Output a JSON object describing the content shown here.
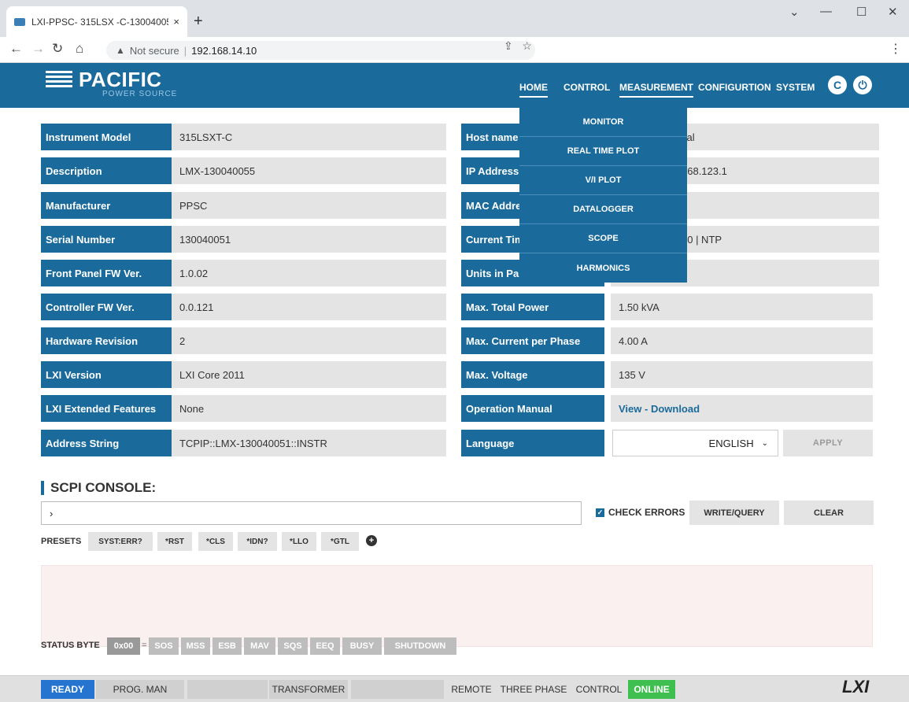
{
  "browser": {
    "tab_title": "LXI-PPSC- 315LSX -C-13004005",
    "tab_close": "×",
    "new_tab": "+",
    "security": "Not secure",
    "url": "192.168.14.10",
    "win_min": "—",
    "win_max": "☐",
    "win_close": "✕",
    "win_chevron": "⌄"
  },
  "brand": {
    "name": "PACIFIC",
    "sub": "POWER SOURCE"
  },
  "nav": [
    "HOME",
    "CONTROL",
    "MEASUREMENT",
    "CONFIGURTION",
    "SYSTEM"
  ],
  "dropdown": [
    "MONITOR",
    "REAL TIME PLOT",
    "V/I PLOT",
    "DATALOGGER",
    "SCOPE",
    "HARMONICS"
  ],
  "left_table": [
    {
      "label": "Instrument Model",
      "value": "315LSXT-C"
    },
    {
      "label": "Description",
      "value": "LMX-130040055"
    },
    {
      "label": "Manufacturer",
      "value": "PPSC"
    },
    {
      "label": "Serial Number",
      "value": "130040051"
    },
    {
      "label": "Front Panel FW Ver.",
      "value": "1.0.02"
    },
    {
      "label": "Controller FW Ver.",
      "value": "0.0.121"
    },
    {
      "label": "Hardware Revision",
      "value": "2"
    },
    {
      "label": "LXI Version",
      "value": "LXI Core 2011"
    },
    {
      "label": "LXI Extended Features",
      "value": "None"
    },
    {
      "label": "Address String",
      "value": "TCPIP::LMX-130040051::INSTR"
    }
  ],
  "right_table": [
    {
      "label": "Host name",
      "value": "cal"
    },
    {
      "label": "IP Address (",
      "value": "168.123.1"
    },
    {
      "label": "MAC Addres",
      "value": ""
    },
    {
      "label": "Current Tim",
      "value": "40 | NTP"
    },
    {
      "label": "Units in Par",
      "value": ""
    },
    {
      "label": "Max. Total Power",
      "value": "1.50 kVA"
    },
    {
      "label": "Max. Current per Phase",
      "value": "4.00 A"
    },
    {
      "label": "Max. Voltage",
      "value": "135 V"
    },
    {
      "label": "Operation Manual",
      "value": "View - Download"
    },
    {
      "label": "Language",
      "value": ""
    }
  ],
  "language": {
    "selected": "ENGLISH",
    "apply": "APPLY"
  },
  "scpi": {
    "title": "SCPI CONSOLE:",
    "prompt": "›",
    "check_errors": "CHECK ERRORS",
    "write_query": "WRITE/QUERY",
    "clear": "CLEAR",
    "presets_label": "PRESETS",
    "presets": [
      "SYST:ERR?",
      "*RST",
      "*CLS",
      "*IDN?",
      "*LLO",
      "*GTL"
    ]
  },
  "status_byte": {
    "label": "STATUS BYTE",
    "value": "0x00",
    "eq": "=",
    "bits": [
      "SOS",
      "MSS",
      "ESB",
      "MAV",
      "SQS",
      "EEQ",
      "BUSY",
      "SHUTDOWN"
    ]
  },
  "footer": {
    "ready": "READY",
    "prog": "PROG. MAN",
    "transformer": "TRANSFORMER",
    "remote": "REMOTE",
    "phase": "THREE PHASE",
    "control": "CONTROL",
    "online": "ONLINE",
    "logo": "LXI"
  },
  "colors": {
    "brand": "#1a6b9b",
    "ready": "#2574d0",
    "online": "#3fbf4f"
  }
}
